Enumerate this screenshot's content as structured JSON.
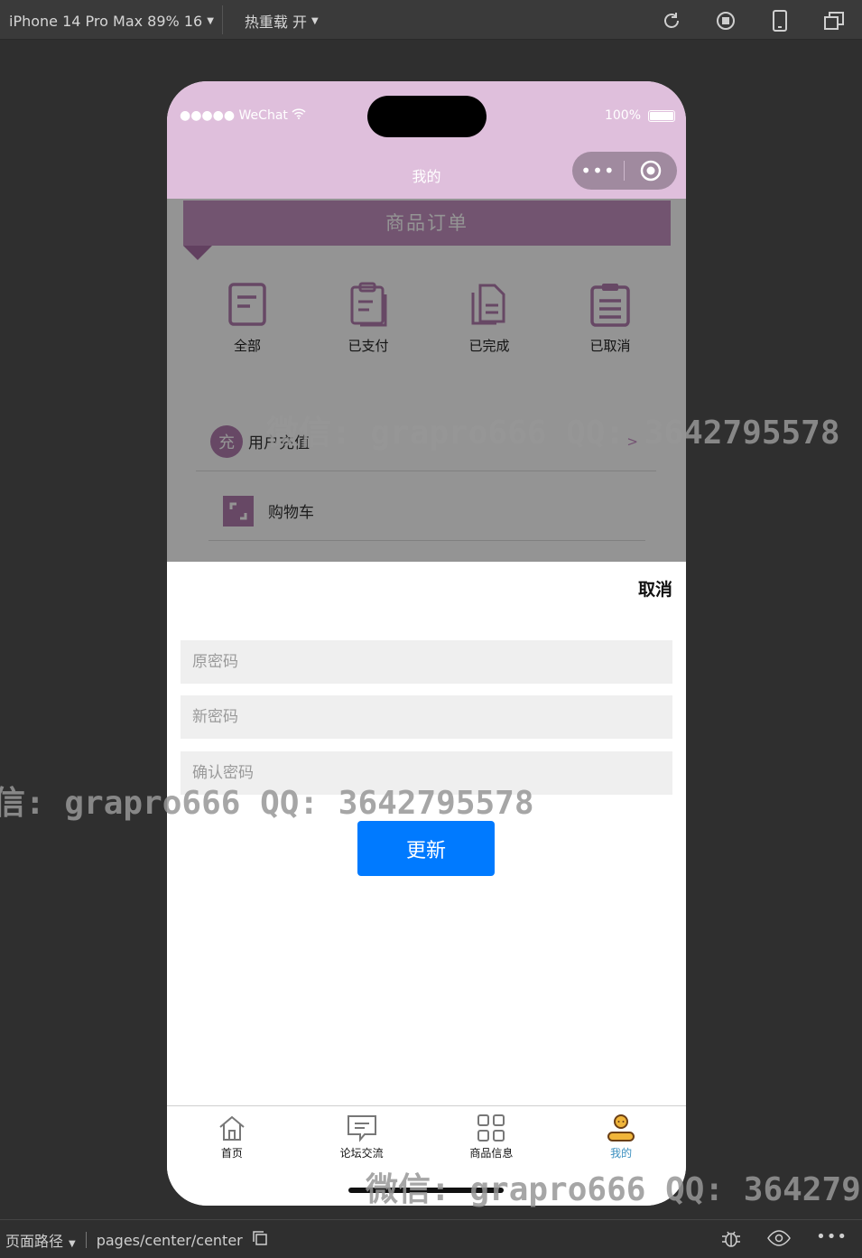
{
  "toolbar": {
    "device": "iPhone 14 Pro Max 89% 16",
    "hot_reload": "热重载 开"
  },
  "status_bar": {
    "carrier": "●●●●● WeChat",
    "battery": "100%"
  },
  "nav": {
    "title": "我的",
    "capsule_menu": "•••"
  },
  "content": {
    "section_title": "商品订单",
    "orders": [
      {
        "label": "全部"
      },
      {
        "label": "已支付"
      },
      {
        "label": "已完成"
      },
      {
        "label": "已取消"
      }
    ],
    "menu": [
      {
        "badge": "充",
        "label": "用户充值",
        "arrow": ">"
      },
      {
        "label": "购物车"
      }
    ]
  },
  "sheet": {
    "cancel": "取消",
    "old_password_placeholder": "原密码",
    "new_password_placeholder": "新密码",
    "confirm_password_placeholder": "确认密码",
    "update_label": "更新"
  },
  "tabbar": [
    {
      "label": "首页"
    },
    {
      "label": "论坛交流"
    },
    {
      "label": "商品信息"
    },
    {
      "label": "我的"
    }
  ],
  "bottom_bar": {
    "path_label": "页面路径",
    "path": "pages/center/center"
  },
  "watermark": {
    "line1": "微信: grapro666 QQ: 3642795578",
    "line2": "信: grapro666 QQ: 3642795578",
    "line3": "微信: grapro666 QQ: 364279"
  },
  "colors": {
    "theme": "#dfbfdc",
    "accent": "#b17caf",
    "button": "#007aff",
    "active_tab": "#3a8fbf"
  }
}
